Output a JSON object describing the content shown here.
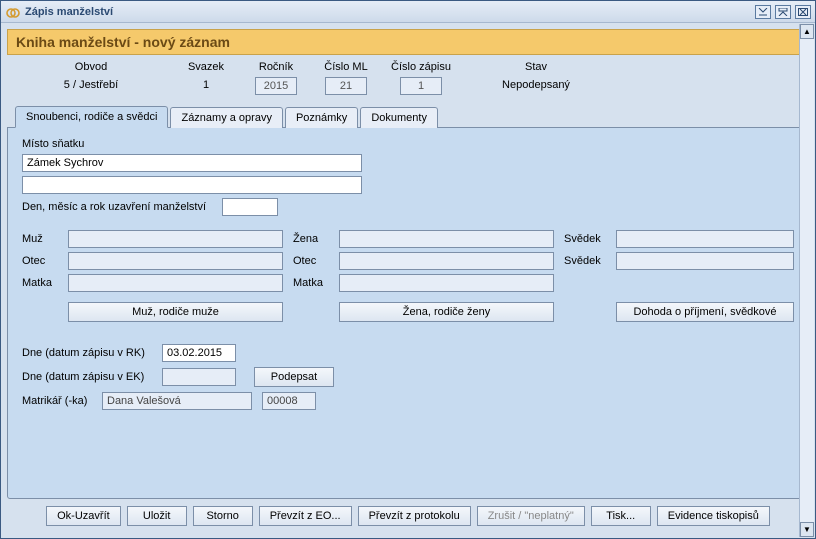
{
  "window": {
    "title": "Zápis manželství"
  },
  "banner": "Kniha manželství - nový záznam",
  "header": {
    "obvod_label": "Obvod",
    "obvod_value": "5 / Jestřebí",
    "svazek_label": "Svazek",
    "svazek_value": "1",
    "rocnik_label": "Ročník",
    "rocnik_value": "2015",
    "cisloml_label": "Číslo ML",
    "cisloml_value": "21",
    "cislozap_label": "Číslo zápisu",
    "cislozap_value": "1",
    "stav_label": "Stav",
    "stav_value": "Nepodepsaný"
  },
  "tabs": {
    "t1": "Snoubenci, rodiče a svědci",
    "t2": "Záznamy a opravy",
    "t3": "Poznámky",
    "t4": "Dokumenty"
  },
  "place": {
    "label": "Místo sňatku",
    "line1": "Zámek Sychrov",
    "line2": ""
  },
  "date_marriage": {
    "label": "Den, měsíc a rok uzavření manželství",
    "value": ""
  },
  "parties": {
    "muz_label": "Muž",
    "muz_value": "",
    "muz_otec_label": "Otec",
    "muz_otec_value": "",
    "muz_matka_label": "Matka",
    "muz_matka_value": "",
    "zena_label": "Žena",
    "zena_value": "",
    "zena_otec_label": "Otec",
    "zena_otec_value": "",
    "zena_matka_label": "Matka",
    "zena_matka_value": "",
    "svedek1_label": "Svědek",
    "svedek1_value": "",
    "svedek2_label": "Svědek",
    "svedek2_value": ""
  },
  "party_buttons": {
    "muz_btn": "Muž, rodiče muže",
    "zena_btn": "Žena, rodiče ženy",
    "dohoda_btn": "Dohoda o příjmení, svědkové"
  },
  "footer_fields": {
    "dne_rk_label": "Dne (datum zápisu v RK)",
    "dne_rk_value": "03.02.2015",
    "dne_ek_label": "Dne (datum zápisu v EK)",
    "dne_ek_value": "",
    "podepsat_btn": "Podepsat",
    "matrikar_label": "Matrikář (-ka)",
    "matrikar_name": "Dana Valešová",
    "matrikar_code": "00008"
  },
  "buttons": {
    "ok": "Ok-Uzavřít",
    "save": "Uložit",
    "storno": "Storno",
    "prevzit_eo": "Převzít z EO...",
    "prevzit_prot": "Převzít z protokolu",
    "zrusit": "Zrušit / \"neplatný\"",
    "tisk": "Tisk...",
    "evidence": "Evidence tiskopisů"
  }
}
